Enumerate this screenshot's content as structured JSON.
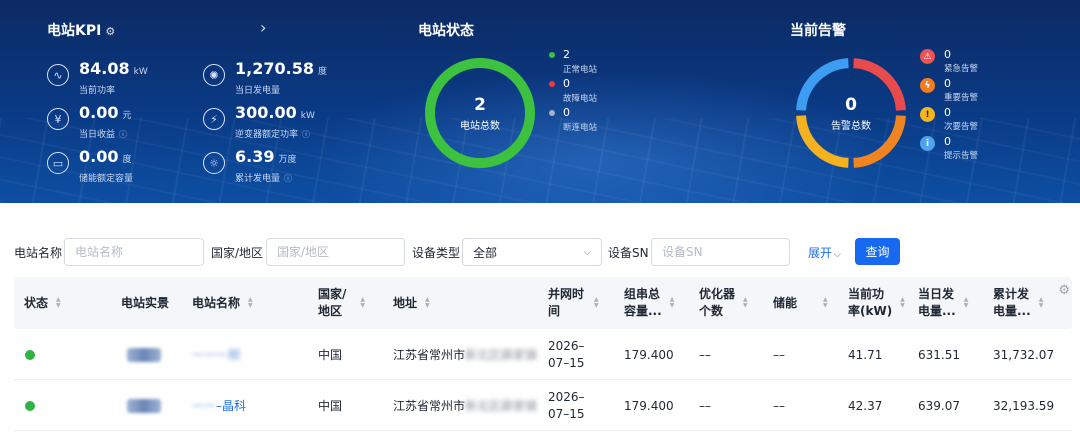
{
  "kpi": {
    "title": "电站KPI",
    "items": [
      {
        "value": "84.08",
        "unit": "kW",
        "label": "当前功率",
        "icon": "power-icon",
        "info": false
      },
      {
        "value": "1,270.58",
        "unit": "度",
        "label": "当日发电量",
        "icon": "energy-icon",
        "info": false
      },
      {
        "value": "0.00",
        "unit": "元",
        "label": "当日收益",
        "icon": "income-icon",
        "info": true
      },
      {
        "value": "300.00",
        "unit": "kW",
        "label": "逆变器额定功率",
        "icon": "inverter-icon",
        "info": true
      },
      {
        "value": "0.00",
        "unit": "度",
        "label": "储能额定容量",
        "icon": "battery-icon",
        "info": false
      },
      {
        "value": "6.39",
        "unit": "万度",
        "label": "累计发电量",
        "icon": "cumulative-icon",
        "info": true
      }
    ]
  },
  "station_status": {
    "title": "电站状态",
    "total_value": "2",
    "total_label": "电站总数",
    "items": [
      {
        "value": "2",
        "label": "正常电站",
        "color": "#3cc23f"
      },
      {
        "value": "0",
        "label": "故障电站",
        "color": "#ef3b3b"
      },
      {
        "value": "0",
        "label": "断连电站",
        "color": "#a7b0bd"
      }
    ]
  },
  "alarms": {
    "title": "当前告警",
    "total_value": "0",
    "total_label": "告警总数",
    "items": [
      {
        "value": "0",
        "label": "紧急告警",
        "color": "#f05252",
        "glyph": "⚠",
        "icon": "urgent-alarm-icon"
      },
      {
        "value": "0",
        "label": "重要告警",
        "color": "#f37d1f",
        "glyph": "ϟ",
        "icon": "important-alarm-icon"
      },
      {
        "value": "0",
        "label": "次要告警",
        "color": "#f5b51b",
        "glyph": "!",
        "icon": "minor-alarm-icon"
      },
      {
        "value": "0",
        "label": "提示告警",
        "color": "#4ea3f1",
        "glyph": "i",
        "icon": "hint-alarm-icon"
      }
    ],
    "ring_colors": [
      "#e84b4b",
      "#f08420",
      "#f4b120",
      "#3d9df2"
    ]
  },
  "filters": {
    "station_name": {
      "label": "电站名称",
      "placeholder": "电站名称"
    },
    "country": {
      "label": "国家/地区",
      "placeholder": "国家/地区"
    },
    "device_type": {
      "label": "设备类型",
      "value": "全部"
    },
    "device_sn": {
      "label": "设备SN",
      "placeholder": "设备SN"
    },
    "expand": "展开",
    "query": "查询"
  },
  "table": {
    "headers": [
      {
        "l1": "状态",
        "sort": true
      },
      {
        "l1": "电站实景",
        "sort": false
      },
      {
        "l1": "电站名称",
        "sort": true
      },
      {
        "l1": "国家/",
        "l2": "地区",
        "sort": true
      },
      {
        "l1": "地址",
        "sort": true
      },
      {
        "l1": "并网时",
        "l2": "间",
        "sort": true
      },
      {
        "l1": "组串总",
        "l2": "容量...",
        "sort": true
      },
      {
        "l1": "优化器",
        "l2": "个数",
        "sort": true
      },
      {
        "l1": "储能",
        "sort": true
      },
      {
        "l1": "当前功",
        "l2": "率(kW)",
        "sort": true
      },
      {
        "l1": "当日发",
        "l2": "电量...",
        "sort": true
      },
      {
        "l1": "累计发",
        "l2": "电量...",
        "sort": true
      }
    ],
    "rows": [
      {
        "name_hidden": "一一一期",
        "name_visible": "",
        "country": "中国",
        "address": "江苏省常州市",
        "address_hidden": "新北区薛家镇",
        "date_l1": "2026–",
        "date_l2": "07–15",
        "capacity": "179.400",
        "optimizers": "––",
        "storage": "––",
        "power": "41.71",
        "daily": "631.51",
        "total": "31,732.07"
      },
      {
        "name_hidden": "一一",
        "name_visible": "–晶科",
        "country": "中国",
        "address": "江苏省常州市",
        "address_hidden": "新北区薛家镇",
        "date_l1": "2026–",
        "date_l2": "07–15",
        "capacity": "179.400",
        "optimizers": "––",
        "storage": "––",
        "power": "42.37",
        "daily": "639.07",
        "total": "32,193.59"
      }
    ]
  }
}
